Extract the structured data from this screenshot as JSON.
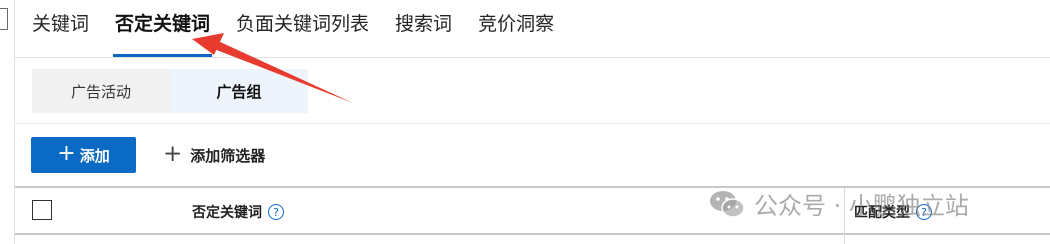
{
  "tabs": [
    {
      "label": "关键词",
      "active": false
    },
    {
      "label": "否定关键词",
      "active": true
    },
    {
      "label": "负面关键词列表",
      "active": false
    },
    {
      "label": "搜索词",
      "active": false
    },
    {
      "label": "竞价洞察",
      "active": false
    }
  ],
  "level_toggle": {
    "campaign_label": "广告活动",
    "ad_group_label": "广告组",
    "selected": "广告组"
  },
  "toolbar": {
    "add_label": "添加",
    "add_filter_label": "添加筛选器"
  },
  "table": {
    "columns": [
      {
        "label": "否定关键词",
        "help_icon": "help-circle-icon"
      },
      {
        "label": "匹配类型",
        "help_icon": "help-circle-icon"
      }
    ]
  },
  "watermark": {
    "text": "公众号 · 小鹏独立站",
    "icon": "wechat-icon"
  },
  "colors": {
    "accent": "#0b6ac4",
    "annotation_arrow": "#e63b2e"
  }
}
